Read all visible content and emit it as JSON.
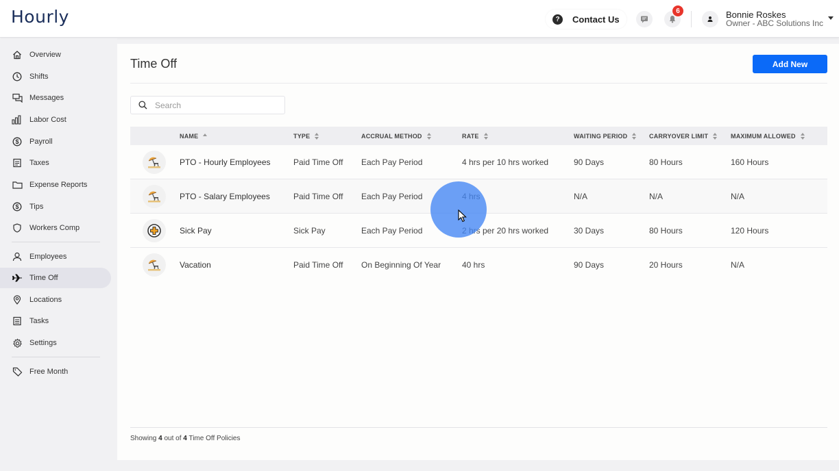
{
  "app": {
    "logo": "Hourly"
  },
  "header": {
    "contact_label": "Contact Us",
    "notification_count": "6",
    "user_name": "Bonnie Roskes",
    "user_role": "Owner - ABC Solutions Inc"
  },
  "sidebar": {
    "items": [
      {
        "label": "Overview",
        "icon": "home-icon"
      },
      {
        "label": "Shifts",
        "icon": "clock-icon"
      },
      {
        "label": "Messages",
        "icon": "chat-icon"
      },
      {
        "label": "Labor Cost",
        "icon": "bar-chart-icon"
      },
      {
        "label": "Payroll",
        "icon": "dollar-icon"
      },
      {
        "label": "Taxes",
        "icon": "document-icon"
      },
      {
        "label": "Expense Reports",
        "icon": "folder-icon"
      },
      {
        "label": "Tips",
        "icon": "dollar-icon"
      },
      {
        "label": "Workers Comp",
        "icon": "shield-icon"
      },
      {
        "label": "Employees",
        "icon": "person-icon"
      },
      {
        "label": "Time Off",
        "icon": "airplane-icon",
        "active": true
      },
      {
        "label": "Locations",
        "icon": "location-pin-icon"
      },
      {
        "label": "Tasks",
        "icon": "list-icon"
      },
      {
        "label": "Settings",
        "icon": "gear-icon"
      },
      {
        "label": "Free Month",
        "icon": "tag-icon"
      }
    ]
  },
  "main": {
    "title": "Time Off",
    "add_button_label": "Add New",
    "search_placeholder": "Search",
    "columns": [
      "NAME",
      "TYPE",
      "ACCRUAL METHOD",
      "RATE",
      "WAITING PERIOD",
      "CARRYOVER LIMIT",
      "MAXIMUM ALLOWED"
    ],
    "rows": [
      {
        "icon": "beach-umbrella-icon",
        "name": "PTO - Hourly Employees",
        "type": "Paid Time Off",
        "accrual": "Each Pay Period",
        "rate": "4 hrs per 10 hrs worked",
        "waiting": "90 Days",
        "carryover": "80 Hours",
        "max": "160 Hours"
      },
      {
        "icon": "beach-umbrella-icon",
        "name": "PTO - Salary Employees",
        "type": "Paid Time Off",
        "accrual": "Each Pay Period",
        "rate": "4 hrs",
        "waiting": "N/A",
        "carryover": "N/A",
        "max": "N/A"
      },
      {
        "icon": "medical-cross-icon",
        "name": "Sick Pay",
        "type": "Sick Pay",
        "accrual": "Each Pay Period",
        "rate": "2 hrs per 20 hrs worked",
        "waiting": "30 Days",
        "carryover": "80 Hours",
        "max": "120 Hours"
      },
      {
        "icon": "beach-umbrella-icon",
        "name": "Vacation",
        "type": "Paid Time Off",
        "accrual": "On Beginning Of Year",
        "rate": "40 hrs",
        "waiting": "90 Days",
        "carryover": "20 Hours",
        "max": "N/A"
      }
    ],
    "footer": {
      "prefix": "Showing",
      "shown": "4",
      "middle": "out of",
      "total": "4",
      "suffix": "Time Off Policies"
    }
  },
  "colors": {
    "accent": "#0b6af8",
    "badge": "#e8352b",
    "logo": "#1a2e5a",
    "click_highlight": "#4285f4"
  }
}
